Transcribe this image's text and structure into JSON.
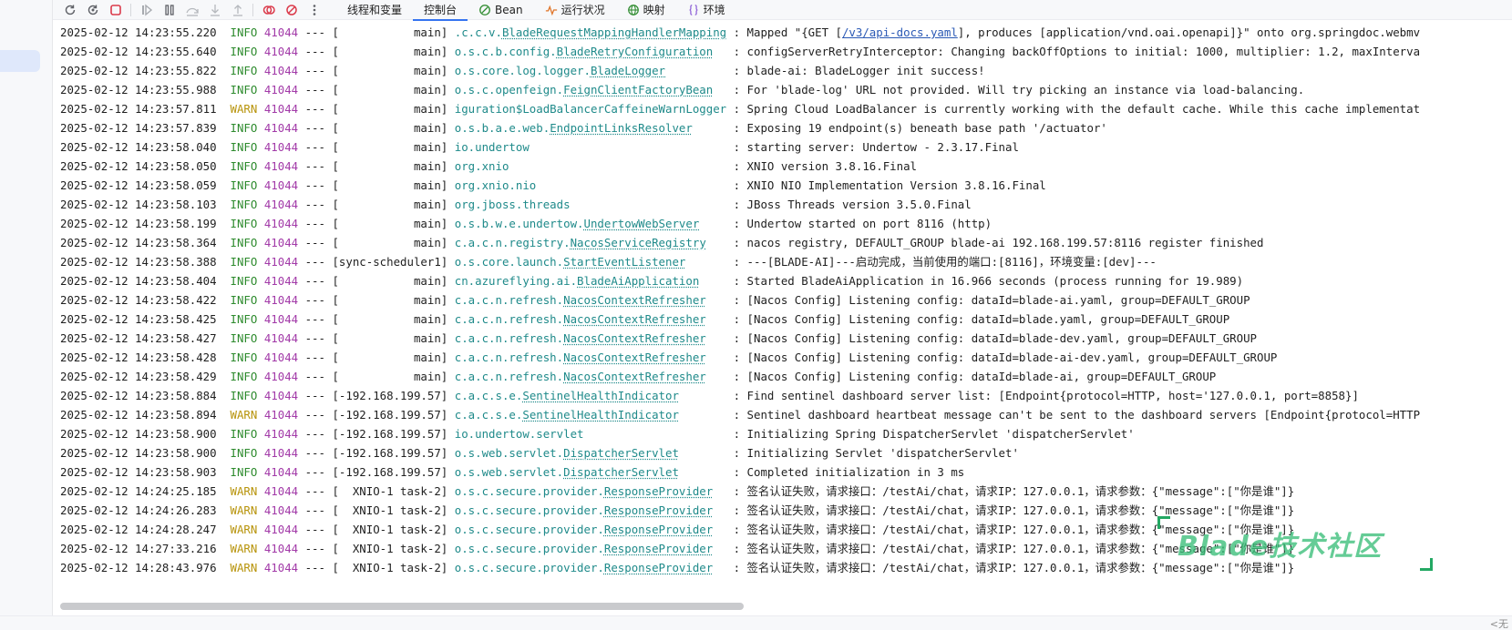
{
  "toolbar": {
    "tabs": [
      {
        "label": "线程和变量",
        "icon": ""
      },
      {
        "label": "控制台",
        "icon": "",
        "active": true
      },
      {
        "label": "Bean",
        "icon": "bean-icon"
      },
      {
        "label": "运行状况",
        "icon": "health-pulse-icon"
      },
      {
        "label": "映射",
        "icon": "mapping-globe-icon"
      },
      {
        "label": "环境",
        "icon": "environment-braces-icon"
      }
    ]
  },
  "colors": {
    "info": "#2e8b2e",
    "warn": "#b7930a",
    "pid": "#a23aa8",
    "logger": "#1f8a8a",
    "link": "#2a59b5",
    "accent": "#3574f0",
    "watermark": "#23a863"
  },
  "log_lines": [
    {
      "ts": "2025-02-12 14:23:55.220",
      "level": "INFO",
      "pid": "41044",
      "sep": "---",
      "thread": "[           main]",
      "logger_pkg": ".c.c.v.",
      "logger_cls": "BladeRequestMappingHandlerMapping",
      "msg": " Mapped \"{GET [",
      "link": "/v3/api-docs.yaml",
      "msg2": "], produces [application/vnd.oai.openapi]}\" onto org.springdoc.webmv"
    },
    {
      "ts": "2025-02-12 14:23:55.640",
      "level": "INFO",
      "pid": "41044",
      "sep": "---",
      "thread": "[           main]",
      "logger_pkg": "o.s.c.b.config.",
      "logger_cls": "BladeRetryConfiguration",
      "msg": " configServerRetryInterceptor: Changing backOffOptions to initial: 1000, multiplier: 1.2, maxInterva"
    },
    {
      "ts": "2025-02-12 14:23:55.822",
      "level": "INFO",
      "pid": "41044",
      "sep": "---",
      "thread": "[           main]",
      "logger_pkg": "o.s.core.log.logger.",
      "logger_cls": "BladeLogger",
      "msg": " blade-ai: BladeLogger init success!"
    },
    {
      "ts": "2025-02-12 14:23:55.988",
      "level": "INFO",
      "pid": "41044",
      "sep": "---",
      "thread": "[           main]",
      "logger_pkg": "o.s.c.openfeign.",
      "logger_cls": "FeignClientFactoryBean",
      "msg": " For 'blade-log' URL not provided. Will try picking an instance via load-balancing."
    },
    {
      "ts": "2025-02-12 14:23:57.811",
      "level": "WARN",
      "pid": "41044",
      "sep": "---",
      "thread": "[           main]",
      "logger_pkg": "iguration$LoadBalancerCaffeineWarnLogger",
      "logger_cls": "",
      "msg": " Spring Cloud LoadBalancer is currently working with the default cache. While this cache implementat"
    },
    {
      "ts": "2025-02-12 14:23:57.839",
      "level": "INFO",
      "pid": "41044",
      "sep": "---",
      "thread": "[           main]",
      "logger_pkg": "o.s.b.a.e.web.",
      "logger_cls": "EndpointLinksResolver",
      "msg": " Exposing 19 endpoint(s) beneath base path '/actuator'"
    },
    {
      "ts": "2025-02-12 14:23:58.040",
      "level": "INFO",
      "pid": "41044",
      "sep": "---",
      "thread": "[           main]",
      "logger_pkg": "io.undertow",
      "logger_cls": "",
      "msg": " starting server: Undertow - 2.3.17.Final"
    },
    {
      "ts": "2025-02-12 14:23:58.050",
      "level": "INFO",
      "pid": "41044",
      "sep": "---",
      "thread": "[           main]",
      "logger_pkg": "org.xnio",
      "logger_cls": "",
      "msg": " XNIO version 3.8.16.Final"
    },
    {
      "ts": "2025-02-12 14:23:58.059",
      "level": "INFO",
      "pid": "41044",
      "sep": "---",
      "thread": "[           main]",
      "logger_pkg": "org.xnio.nio",
      "logger_cls": "",
      "msg": " XNIO NIO Implementation Version 3.8.16.Final"
    },
    {
      "ts": "2025-02-12 14:23:58.103",
      "level": "INFO",
      "pid": "41044",
      "sep": "---",
      "thread": "[           main]",
      "logger_pkg": "org.jboss.threads",
      "logger_cls": "",
      "msg": " JBoss Threads version 3.5.0.Final"
    },
    {
      "ts": "2025-02-12 14:23:58.199",
      "level": "INFO",
      "pid": "41044",
      "sep": "---",
      "thread": "[           main]",
      "logger_pkg": "o.s.b.w.e.undertow.",
      "logger_cls": "UndertowWebServer",
      "msg": " Undertow started on port 8116 (http)"
    },
    {
      "ts": "2025-02-12 14:23:58.364",
      "level": "INFO",
      "pid": "41044",
      "sep": "---",
      "thread": "[           main]",
      "logger_pkg": "c.a.c.n.registry.",
      "logger_cls": "NacosServiceRegistry",
      "msg": " nacos registry, DEFAULT_GROUP blade-ai 192.168.199.57:8116 register finished"
    },
    {
      "ts": "2025-02-12 14:23:58.388",
      "level": "INFO",
      "pid": "41044",
      "sep": "---",
      "thread": "[sync-scheduler1]",
      "logger_pkg": "o.s.core.launch.",
      "logger_cls": "StartEventListener",
      "msg": " ---[BLADE-AI]---启动完成，当前使用的端口:[8116]，环境变量:[dev]---"
    },
    {
      "ts": "2025-02-12 14:23:58.404",
      "level": "INFO",
      "pid": "41044",
      "sep": "---",
      "thread": "[           main]",
      "logger_pkg": "cn.azureflying.ai.",
      "logger_cls": "BladeAiApplication",
      "msg": " Started BladeAiApplication in 16.966 seconds (process running for 19.989)"
    },
    {
      "ts": "2025-02-12 14:23:58.422",
      "level": "INFO",
      "pid": "41044",
      "sep": "---",
      "thread": "[           main]",
      "logger_pkg": "c.a.c.n.refresh.",
      "logger_cls": "NacosContextRefresher",
      "msg": " [Nacos Config] Listening config: dataId=blade-ai.yaml, group=DEFAULT_GROUP"
    },
    {
      "ts": "2025-02-12 14:23:58.425",
      "level": "INFO",
      "pid": "41044",
      "sep": "---",
      "thread": "[           main]",
      "logger_pkg": "c.a.c.n.refresh.",
      "logger_cls": "NacosContextRefresher",
      "msg": " [Nacos Config] Listening config: dataId=blade.yaml, group=DEFAULT_GROUP"
    },
    {
      "ts": "2025-02-12 14:23:58.427",
      "level": "INFO",
      "pid": "41044",
      "sep": "---",
      "thread": "[           main]",
      "logger_pkg": "c.a.c.n.refresh.",
      "logger_cls": "NacosContextRefresher",
      "msg": " [Nacos Config] Listening config: dataId=blade-dev.yaml, group=DEFAULT_GROUP"
    },
    {
      "ts": "2025-02-12 14:23:58.428",
      "level": "INFO",
      "pid": "41044",
      "sep": "---",
      "thread": "[           main]",
      "logger_pkg": "c.a.c.n.refresh.",
      "logger_cls": "NacosContextRefresher",
      "msg": " [Nacos Config] Listening config: dataId=blade-ai-dev.yaml, group=DEFAULT_GROUP"
    },
    {
      "ts": "2025-02-12 14:23:58.429",
      "level": "INFO",
      "pid": "41044",
      "sep": "---",
      "thread": "[           main]",
      "logger_pkg": "c.a.c.n.refresh.",
      "logger_cls": "NacosContextRefresher",
      "msg": " [Nacos Config] Listening config: dataId=blade-ai, group=DEFAULT_GROUP"
    },
    {
      "ts": "2025-02-12 14:23:58.884",
      "level": "INFO",
      "pid": "41044",
      "sep": "---",
      "thread": "[-192.168.199.57]",
      "logger_pkg": "c.a.c.s.e.",
      "logger_cls": "SentinelHealthIndicator",
      "msg": " Find sentinel dashboard server list: [Endpoint{protocol=HTTP, host='127.0.0.1, port=8858}]"
    },
    {
      "ts": "2025-02-12 14:23:58.894",
      "level": "WARN",
      "pid": "41044",
      "sep": "---",
      "thread": "[-192.168.199.57]",
      "logger_pkg": "c.a.c.s.e.",
      "logger_cls": "SentinelHealthIndicator",
      "msg": " Sentinel dashboard heartbeat message can't be sent to the dashboard servers [Endpoint{protocol=HTTP"
    },
    {
      "ts": "2025-02-12 14:23:58.900",
      "level": "INFO",
      "pid": "41044",
      "sep": "---",
      "thread": "[-192.168.199.57]",
      "logger_pkg": "io.undertow.servlet",
      "logger_cls": "",
      "msg": " Initializing Spring DispatcherServlet 'dispatcherServlet'"
    },
    {
      "ts": "2025-02-12 14:23:58.900",
      "level": "INFO",
      "pid": "41044",
      "sep": "---",
      "thread": "[-192.168.199.57]",
      "logger_pkg": "o.s.web.servlet.",
      "logger_cls": "DispatcherServlet",
      "msg": " Initializing Servlet 'dispatcherServlet'"
    },
    {
      "ts": "2025-02-12 14:23:58.903",
      "level": "INFO",
      "pid": "41044",
      "sep": "---",
      "thread": "[-192.168.199.57]",
      "logger_pkg": "o.s.web.servlet.",
      "logger_cls": "DispatcherServlet",
      "msg": " Completed initialization in 3 ms"
    },
    {
      "ts": "2025-02-12 14:24:25.185",
      "level": "WARN",
      "pid": "41044",
      "sep": "---",
      "thread": "[  XNIO-1 task-2]",
      "logger_pkg": "o.s.c.secure.provider.",
      "logger_cls": "ResponseProvider",
      "msg": " 签名认证失败，请求接口：/testAi/chat，请求IP：127.0.0.1，请求参数：{\"message\":[\"你是谁\"]}"
    },
    {
      "ts": "2025-02-12 14:24:26.283",
      "level": "WARN",
      "pid": "41044",
      "sep": "---",
      "thread": "[  XNIO-1 task-2]",
      "logger_pkg": "o.s.c.secure.provider.",
      "logger_cls": "ResponseProvider",
      "msg": " 签名认证失败，请求接口：/testAi/chat，请求IP：127.0.0.1，请求参数：{\"message\":[\"你是谁\"]}"
    },
    {
      "ts": "2025-02-12 14:24:28.247",
      "level": "WARN",
      "pid": "41044",
      "sep": "---",
      "thread": "[  XNIO-1 task-2]",
      "logger_pkg": "o.s.c.secure.provider.",
      "logger_cls": "ResponseProvider",
      "msg": " 签名认证失败，请求接口：/testAi/chat，请求IP：127.0.0.1，请求参数：{\"message\":[\"你是谁\"]}"
    },
    {
      "ts": "2025-02-12 14:27:33.216",
      "level": "WARN",
      "pid": "41044",
      "sep": "---",
      "thread": "[  XNIO-1 task-2]",
      "logger_pkg": "o.s.c.secure.provider.",
      "logger_cls": "ResponseProvider",
      "msg": " 签名认证失败，请求接口：/testAi/chat，请求IP：127.0.0.1，请求参数：{\"message\":[\"你是谁\"]}"
    },
    {
      "ts": "2025-02-12 14:28:43.976",
      "level": "WARN",
      "pid": "41044",
      "sep": "---",
      "thread": "[  XNIO-1 task-2]",
      "logger_pkg": "o.s.c.secure.provider.",
      "logger_cls": "ResponseProvider",
      "msg": " 签名认证失败，请求接口：/testAi/chat，请求IP：127.0.0.1，请求参数：{\"message\":[\"你是谁\"]}"
    }
  ],
  "watermark": {
    "text": "Blade技术社区"
  },
  "status": {
    "end_label": "<无"
  }
}
